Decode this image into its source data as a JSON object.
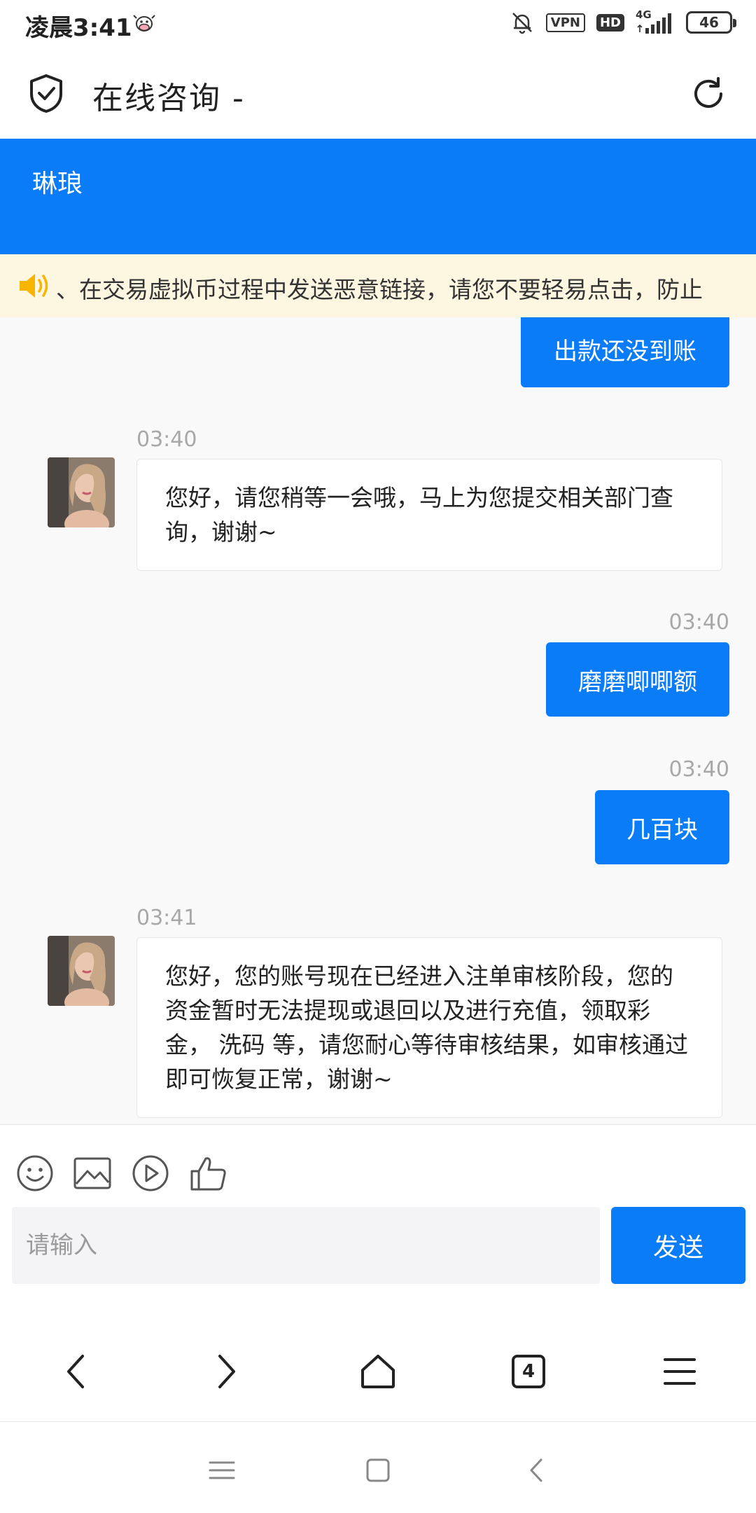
{
  "status_bar": {
    "time": "凌晨3:41",
    "vpn": "VPN",
    "hd": "HD",
    "network": "4G",
    "battery": "46"
  },
  "header": {
    "title": "在线咨询 -"
  },
  "banner": {
    "agent_name": "琳琅"
  },
  "notice": {
    "text": "、在交易虚拟币过程中发送恶意链接，请您不要轻易点击，防止"
  },
  "messages": [
    {
      "side": "out",
      "text": "出款还没到账"
    },
    {
      "side": "in",
      "time": "03:40",
      "text": "您好，请您稍等一会哦，马上为您提交相关部门查询，谢谢~"
    },
    {
      "side": "out",
      "time": "03:40",
      "text": "磨磨唧唧额"
    },
    {
      "side": "out",
      "time": "03:40",
      "text": "几百块"
    },
    {
      "side": "in",
      "time": "03:41",
      "text": "您好，您的账号现在已经进入注单审核阶段，您的资金暂时无法提现或退回以及进行充值，领取彩金， 洗码 等，请您耐心等待审核结果，如审核通过即可恢复正常，谢谢~"
    }
  ],
  "composer": {
    "placeholder": "请输入",
    "send_label": "发送"
  },
  "browser_nav": {
    "tab_count": "4"
  },
  "colors": {
    "accent": "#0a7cf8",
    "notice_bg": "#fdf6e0",
    "chat_bg": "#f9f9fa"
  }
}
